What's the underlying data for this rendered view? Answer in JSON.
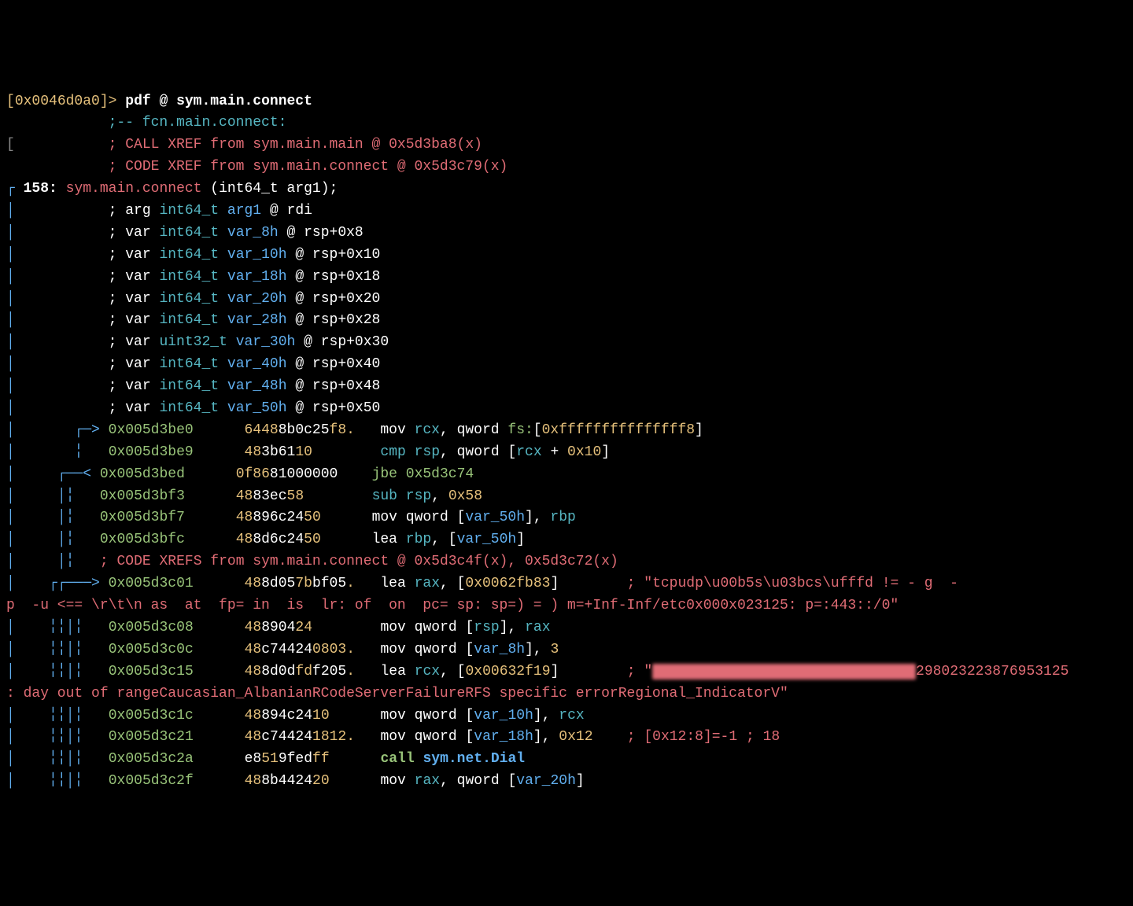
{
  "prompt": {
    "addr": "0x0046d0a0",
    "cmd": "pdf @ sym.main.connect"
  },
  "header": {
    "fcn_label": ";-- fcn.main.connect:",
    "xref_call": "; CALL XREF from sym.main.main @ 0x5d3ba8(x)",
    "xref_code": "; CODE XREF from sym.main.connect @ 0x5d3c79(x)"
  },
  "fn": {
    "size": "158:",
    "name": "sym.main.connect",
    "proto": "(int64_t arg1);"
  },
  "args": [
    "; arg int64_t arg1 @ rdi"
  ],
  "vars": [
    "; var int64_t var_8h @ rsp+0x8",
    "; var int64_t var_10h @ rsp+0x10",
    "; var int64_t var_18h @ rsp+0x18",
    "; var int64_t var_20h @ rsp+0x20",
    "; var int64_t var_28h @ rsp+0x28",
    "; var uint32_t var_30h @ rsp+0x30",
    "; var int64_t var_40h @ rsp+0x40",
    "; var int64_t var_48h @ rsp+0x48",
    "; var int64_t var_50h @ rsp+0x50"
  ],
  "xref_mid": "; CODE XREFS from sym.main.connect @ 0x5d3c4f(x), 0x5d3c72(x)",
  "asm": {
    "l0": {
      "addr": "0x005d3be0",
      "bytes": "64488b0c25f8.",
      "op": "mov rcx, qword fs:[0xfffffffffffffff8]"
    },
    "l1": {
      "addr": "0x005d3be9",
      "bytes": "483b6110",
      "op": "cmp rsp, qword [rcx + 0x10]"
    },
    "l2": {
      "addr": "0x005d3bed",
      "bytes": "0f8681000000",
      "op": "jbe 0x5d3c74"
    },
    "l3": {
      "addr": "0x005d3bf3",
      "bytes": "4883ec58",
      "op": "sub rsp, 0x58"
    },
    "l4": {
      "addr": "0x005d3bf7",
      "bytes": "48896c2450",
      "op": "mov qword [var_50h], rbp"
    },
    "l5": {
      "addr": "0x005d3bfc",
      "bytes": "488d6c2450",
      "op": "lea rbp, [var_50h]"
    },
    "l6": {
      "addr": "0x005d3c01",
      "bytes": "488d057bbf05.",
      "op": "lea rax, [0x0062fb83]",
      "cmt": "; \"tcpudp\\u00b5s\\u03bcs\\ufffd != - g  -"
    },
    "l6b": "p  -u <== \\r\\t\\n as  at  fp= in  is  lr: of  on  pc= sp: sp=) = ) m=+Inf-Inf/etc0x000x023125: p=:443::/0\"",
    "l7": {
      "addr": "0x005d3c08",
      "bytes": "48890424",
      "op": "mov qword [rsp], rax"
    },
    "l8": {
      "addr": "0x005d3c0c",
      "bytes": "48c744240803.",
      "op": "mov qword [var_8h], 3"
    },
    "l9": {
      "addr": "0x005d3c15",
      "bytes": "488d0dfdf205.",
      "op": "lea rcx, [0x00632f19]",
      "cmt": "; \"",
      "redacted": "XXXXXXXXXXXXXXXXXXXXXXXXXXXXXXX",
      "tail": "298023223876953125"
    },
    "l9b": ": day out of rangeCaucasian_AlbanianRCodeServerFailureRFS specific errorRegional_IndicatorV\"",
    "l10": {
      "addr": "0x005d3c1c",
      "bytes": "48894c2410",
      "op": "mov qword [var_10h], rcx"
    },
    "l11": {
      "addr": "0x005d3c21",
      "bytes": "48c744241812.",
      "op": "mov qword [var_18h], 0x12",
      "cmt": "; [0x12:8]=-1 ; 18"
    },
    "l12": {
      "addr": "0x005d3c2a",
      "bytes": "e8519fedff",
      "op": "call sym.net.Dial"
    },
    "l13": {
      "addr": "0x005d3c2f",
      "bytes": "488b442420",
      "op": "mov rax, qword [var_20h]"
    }
  }
}
